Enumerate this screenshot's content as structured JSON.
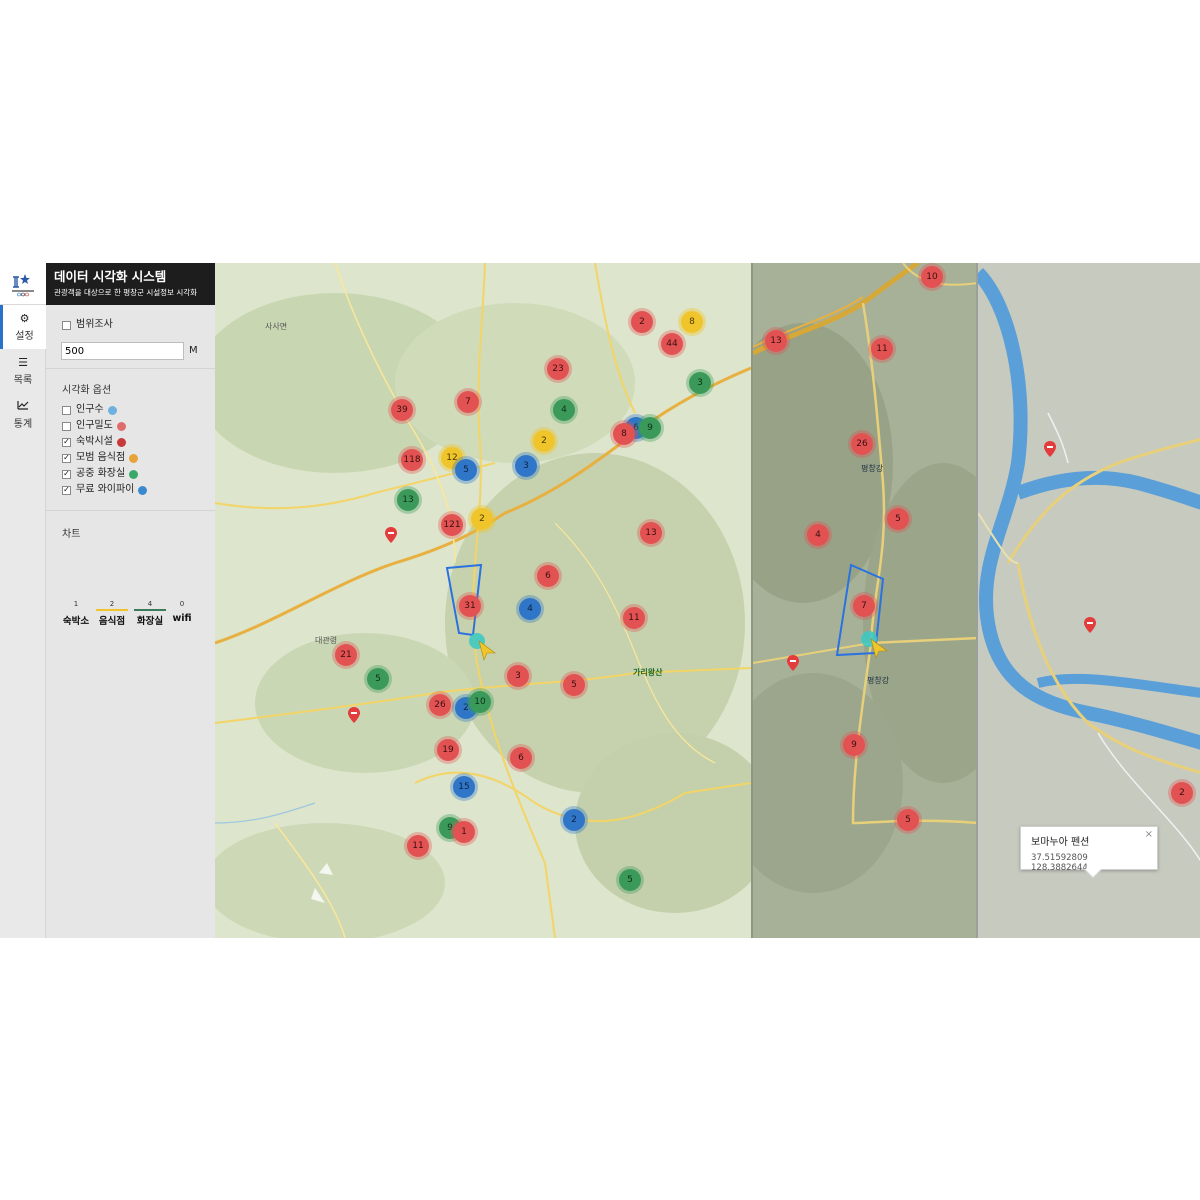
{
  "app": {
    "title": "데이터 시각화 시스템",
    "subtitle": "관광객을 대상으로 한 평창군 시설정보 시각화"
  },
  "rail": {
    "items": [
      {
        "label": "설정",
        "icon": "gear-icon"
      },
      {
        "label": "목록",
        "icon": "list-icon"
      },
      {
        "label": "통계",
        "icon": "line-chart-icon"
      }
    ]
  },
  "settings": {
    "range_survey": {
      "label": "범위조사",
      "checked": false
    },
    "radius": {
      "value": "500",
      "unit": "M"
    },
    "viz_options_title": "시각화 옵션",
    "options": [
      {
        "label": "인구수",
        "checked": false,
        "icon": "globe-icon",
        "color": "#6fb0e0"
      },
      {
        "label": "인구밀도",
        "checked": false,
        "icon": "density-icon",
        "color": "#e06b6b"
      },
      {
        "label": "숙박시설",
        "checked": true,
        "icon": "bed-icon",
        "color": "#c83a3a"
      },
      {
        "label": "모범 음식점",
        "checked": true,
        "icon": "food-icon",
        "color": "#e8a23a"
      },
      {
        "label": "공중 화장실",
        "checked": true,
        "icon": "toilet-icon",
        "color": "#3aa86a"
      },
      {
        "label": "무료 와이파이",
        "checked": true,
        "icon": "wifi-icon",
        "color": "#3a8ad0"
      }
    ],
    "chart_title": "차트",
    "chart_legend": [
      {
        "label": "숙박소",
        "value": "1",
        "color": "#e6e6e6"
      },
      {
        "label": "음식점",
        "value": "2",
        "color": "#f0c52c"
      },
      {
        "label": "화장실",
        "value": "4",
        "color": "#3b7a5a"
      },
      {
        "label": "wifi",
        "value": "0",
        "color": "#e6e6e6"
      }
    ]
  },
  "map1": {
    "clusters": [
      {
        "v": "2",
        "c": "red"
      },
      {
        "v": "8",
        "c": "yellow"
      },
      {
        "v": "44",
        "c": "red"
      },
      {
        "v": "23",
        "c": "red"
      },
      {
        "v": "3",
        "c": "green"
      },
      {
        "v": "39",
        "c": "red"
      },
      {
        "v": "7",
        "c": "red"
      },
      {
        "v": "4",
        "c": "green"
      },
      {
        "v": "2",
        "c": "yellow"
      },
      {
        "v": "6",
        "c": "blue"
      },
      {
        "v": "9",
        "c": "green"
      },
      {
        "v": "8",
        "c": "red"
      },
      {
        "v": "118",
        "c": "red"
      },
      {
        "v": "12",
        "c": "yellow"
      },
      {
        "v": "5",
        "c": "blue"
      },
      {
        "v": "3",
        "c": "blue"
      },
      {
        "v": "13",
        "c": "green"
      },
      {
        "v": "121",
        "c": "red"
      },
      {
        "v": "2",
        "c": "yellow"
      },
      {
        "v": "13",
        "c": "red"
      },
      {
        "v": "6",
        "c": "red"
      },
      {
        "v": "31",
        "c": "red"
      },
      {
        "v": "4",
        "c": "blue"
      },
      {
        "v": "11",
        "c": "red"
      },
      {
        "v": "21",
        "c": "red"
      },
      {
        "v": "5",
        "c": "green"
      },
      {
        "v": "3",
        "c": "red"
      },
      {
        "v": "5",
        "c": "red"
      },
      {
        "v": "26",
        "c": "red"
      },
      {
        "v": "2",
        "c": "blue"
      },
      {
        "v": "10",
        "c": "green"
      },
      {
        "v": "19",
        "c": "red"
      },
      {
        "v": "6",
        "c": "red"
      },
      {
        "v": "15",
        "c": "blue"
      },
      {
        "v": "9",
        "c": "green"
      },
      {
        "v": "1",
        "c": "red"
      },
      {
        "v": "2",
        "c": "blue"
      },
      {
        "v": "11",
        "c": "red"
      },
      {
        "v": "5",
        "c": "green"
      }
    ],
    "labels": [
      {
        "t": "가리왕산"
      },
      {
        "t": "사사면"
      },
      {
        "t": "대관령"
      }
    ]
  },
  "map2": {
    "clusters": [
      {
        "v": "10",
        "c": "red"
      },
      {
        "v": "13",
        "c": "red"
      },
      {
        "v": "11",
        "c": "red"
      },
      {
        "v": "26",
        "c": "red"
      },
      {
        "v": "5",
        "c": "red"
      },
      {
        "v": "4",
        "c": "red"
      },
      {
        "v": "7",
        "c": "red"
      },
      {
        "v": "9",
        "c": "red"
      },
      {
        "v": "5",
        "c": "red"
      }
    ],
    "labels": [
      {
        "t": "평창강"
      },
      {
        "t": "평창강"
      }
    ]
  },
  "map3": {
    "clusters": [
      {
        "v": "2",
        "c": "red"
      }
    ]
  },
  "popup": {
    "name": "보마누아 펜션",
    "coords": "37.51592809 128.3882644",
    "close": "×"
  }
}
